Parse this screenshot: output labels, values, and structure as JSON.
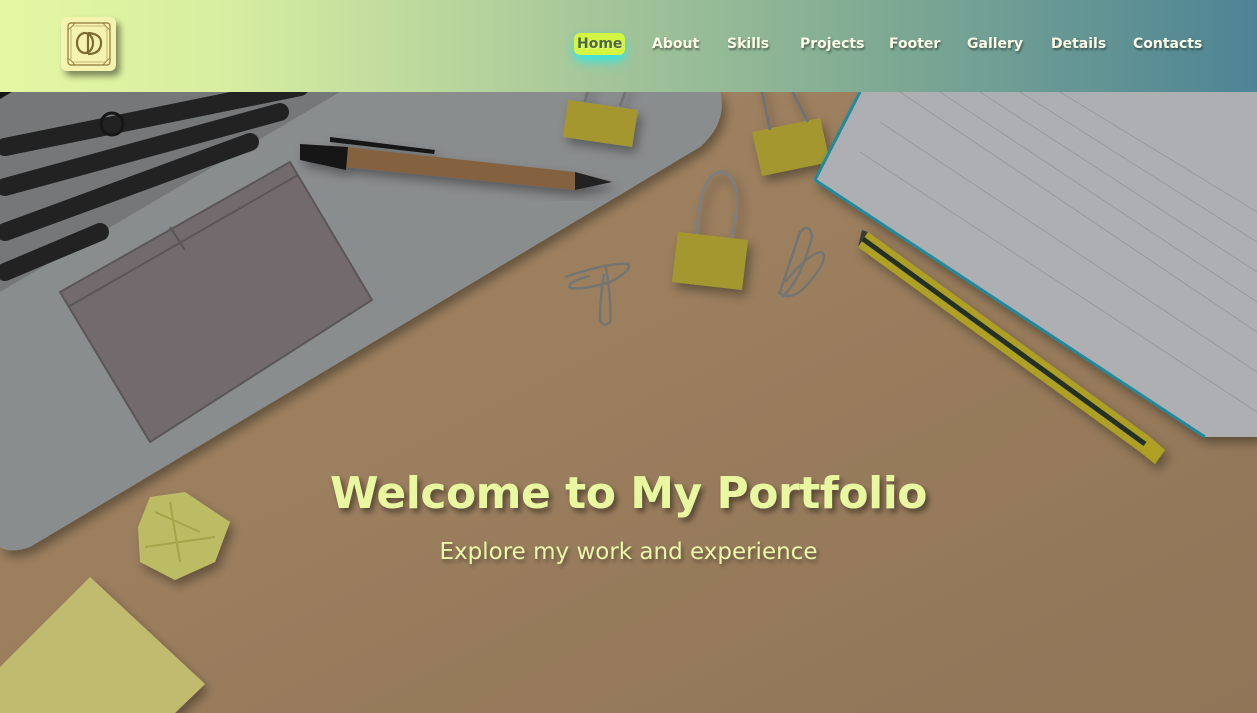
{
  "logo": {
    "monogram": "OD"
  },
  "nav": {
    "items": [
      {
        "label": "Home",
        "active": true
      },
      {
        "label": "About"
      },
      {
        "label": "Skills"
      },
      {
        "label": "Projects"
      },
      {
        "label": "Footer"
      },
      {
        "label": "Gallery"
      },
      {
        "label": "Details"
      },
      {
        "label": "Contacts"
      }
    ]
  },
  "hero": {
    "title": "Welcome to My Portfolio",
    "subtitle": "Explore my work and experience"
  },
  "colors": {
    "header_start": "#e4f7a2",
    "header_end": "#4d8495",
    "active_nav_bg": "#d4f542",
    "active_nav_glow": "#3fe4dc",
    "hero_text": "#e8f7a0"
  }
}
